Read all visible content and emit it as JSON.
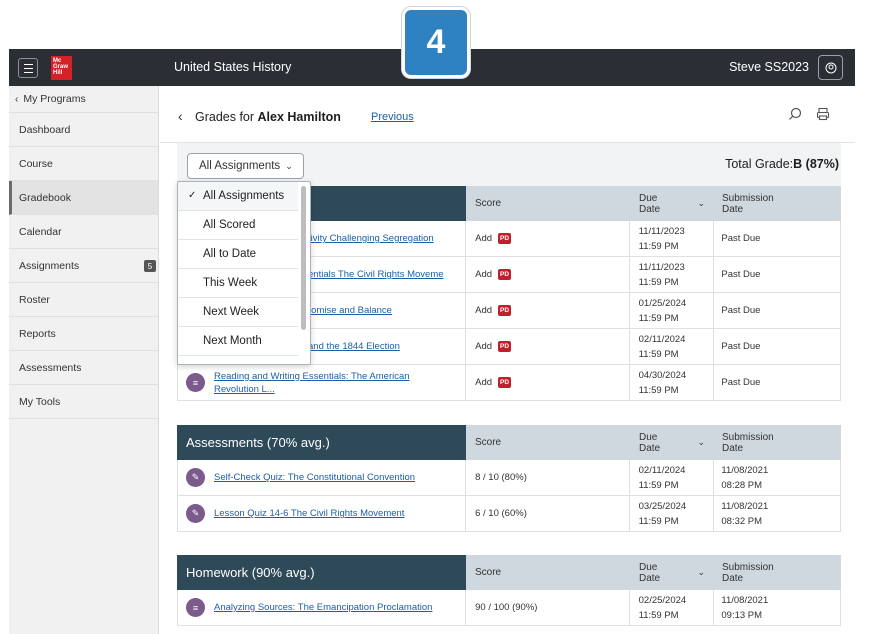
{
  "step_number": "4",
  "header": {
    "logo_text": "Mc Graw Hill",
    "app_title": "United States History",
    "user_name": "Steve SS2023"
  },
  "sidebar": {
    "back_label": "My Programs",
    "items": [
      {
        "label": "Dashboard"
      },
      {
        "label": "Course"
      },
      {
        "label": "Gradebook",
        "active": true
      },
      {
        "label": "Calendar"
      },
      {
        "label": "Assignments",
        "badge": "5"
      },
      {
        "label": "Roster"
      },
      {
        "label": "Reports"
      },
      {
        "label": "Assessments"
      },
      {
        "label": "My Tools"
      }
    ]
  },
  "grades": {
    "title_prefix": "Grades for ",
    "student_name": "Alex Hamilton",
    "previous_link": "Previous",
    "filter_value": "All Assignments",
    "total_grade_label": "Total Grade:",
    "total_grade_value": "B (87%)"
  },
  "dropdown": {
    "options": [
      "All Assignments",
      "All Scored",
      "All to Date",
      "This Week",
      "Next Week",
      "Next Month"
    ],
    "selected": "All Assignments"
  },
  "columns": {
    "score": "Score",
    "due": "Due Date",
    "submission": "Submission Date"
  },
  "section1": {
    "rows": [
      {
        "title": "tivity Challenging Segregation",
        "score": "Add",
        "due1": "11/11/2023",
        "due2": "11:59 PM",
        "submission1": "Past Due",
        "submission2": ""
      },
      {
        "title": "entials The Civil Rights Moveme",
        "score": "Add",
        "due1": "11/11/2023",
        "due2": "11:59 PM",
        "submission1": "Past Due",
        "submission2": ""
      },
      {
        "title": "romise and Balance",
        "score": "Add",
        "due1": "01/25/2024",
        "due2": "11:59 PM",
        "submission1": "Past Due",
        "submission2": ""
      },
      {
        "title": "and the 1844 Election",
        "score": "Add",
        "due1": "02/11/2024",
        "due2": "11:59 PM",
        "submission1": "Past Due",
        "submission2": ""
      },
      {
        "title": "Reading and Writing Essentials: The American Revolution L...",
        "score": "Add",
        "due1": "04/30/2024",
        "due2": "11:59 PM",
        "submission1": "Past Due",
        "submission2": ""
      }
    ]
  },
  "section2": {
    "title": "Assessments (70% avg.)",
    "rows": [
      {
        "title": "Self-Check Quiz: The Constitutional Convention",
        "score": "8 / 10 (80%)",
        "due1": "02/11/2024",
        "due2": "11:59 PM",
        "submission1": "11/08/2021",
        "submission2": "08:28 PM"
      },
      {
        "title": "Lesson Quiz 14-6 The Civil Rights Movement",
        "score": "6 / 10 (60%)",
        "due1": "03/25/2024",
        "due2": "11:59 PM",
        "submission1": "11/08/2021",
        "submission2": "08:32 PM"
      }
    ]
  },
  "section3": {
    "title": "Homework (90% avg.)",
    "rows": [
      {
        "title": "Analyzing Sources: The Emancipation Proclamation",
        "score": "90 / 100 (90%)",
        "due1": "02/25/2024",
        "due2": "11:59 PM",
        "submission1": "11/08/2021",
        "submission2": "09:13 PM"
      }
    ]
  },
  "pd_badge_text": "PD",
  "colors": {
    "topbar": "#2b2f35",
    "section_header": "#2e4a59",
    "link": "#1b5fa8",
    "badge_blue": "#2f82c2",
    "pd_red": "#c0202b",
    "activity_icon": "#7b5a8c"
  }
}
